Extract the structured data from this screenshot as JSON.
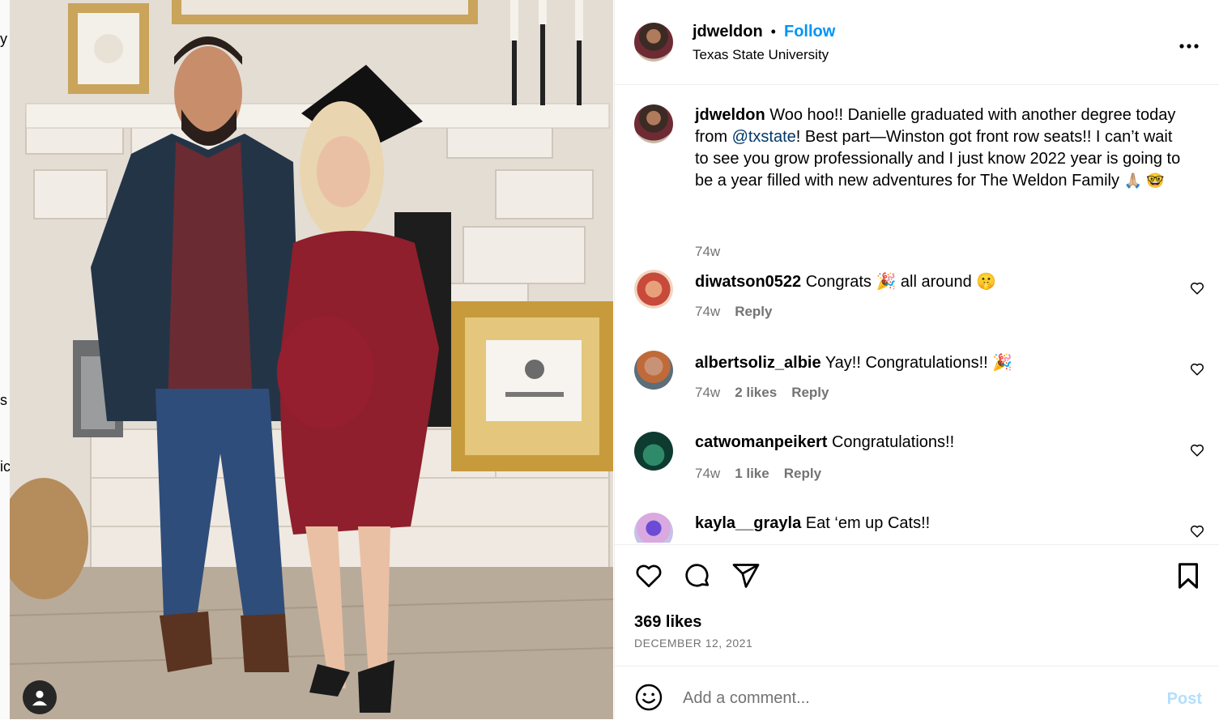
{
  "backdrop": {
    "frag1": "y",
    "frag2": "s",
    "frag3": "ic"
  },
  "post": {
    "username": "jdweldon",
    "separator": "•",
    "follow_label": "Follow",
    "location": "Texas State University",
    "more_label": "•••"
  },
  "caption": {
    "username": "jdweldon",
    "text_before_mention": "Woo hoo!! Danielle graduated with another degree today from ",
    "mention": "@txstate",
    "text_after_mention": "! Best part—Winston got front row seats!! I can’t wait to see you grow professionally and I just know 2022 year is going to be a year filled with new adventures for The Weldon Family ",
    "emojis": "🙏🏼 🤓",
    "time": "74w"
  },
  "comments": [
    {
      "username": "diwatson0522",
      "text": "Congrats 🎉 all around 🤫",
      "time": "74w",
      "likes": "",
      "reply": "Reply"
    },
    {
      "username": "albertsoliz_albie",
      "text": "Yay!! Congratulations!! 🎉",
      "time": "74w",
      "likes": "2 likes",
      "reply": "Reply"
    },
    {
      "username": "catwomanpeikert",
      "text": "Congratulations!!",
      "time": "74w",
      "likes": "1 like",
      "reply": "Reply"
    },
    {
      "username": "kayla__grayla",
      "text": "Eat ‘em up Cats!!",
      "time": "",
      "likes": "",
      "reply": ""
    }
  ],
  "stats": {
    "likes": "369 likes",
    "date": "DECEMBER 12, 2021"
  },
  "composer": {
    "placeholder": "Add a comment...",
    "post_label": "Post"
  },
  "colors": {
    "link_blue": "#0095f6",
    "muted": "#737373",
    "mention": "#00376b"
  },
  "icons": [
    "heart-icon",
    "comment-icon",
    "share-icon",
    "bookmark-icon",
    "emoji-icon",
    "more-icon",
    "user-tag-icon"
  ]
}
